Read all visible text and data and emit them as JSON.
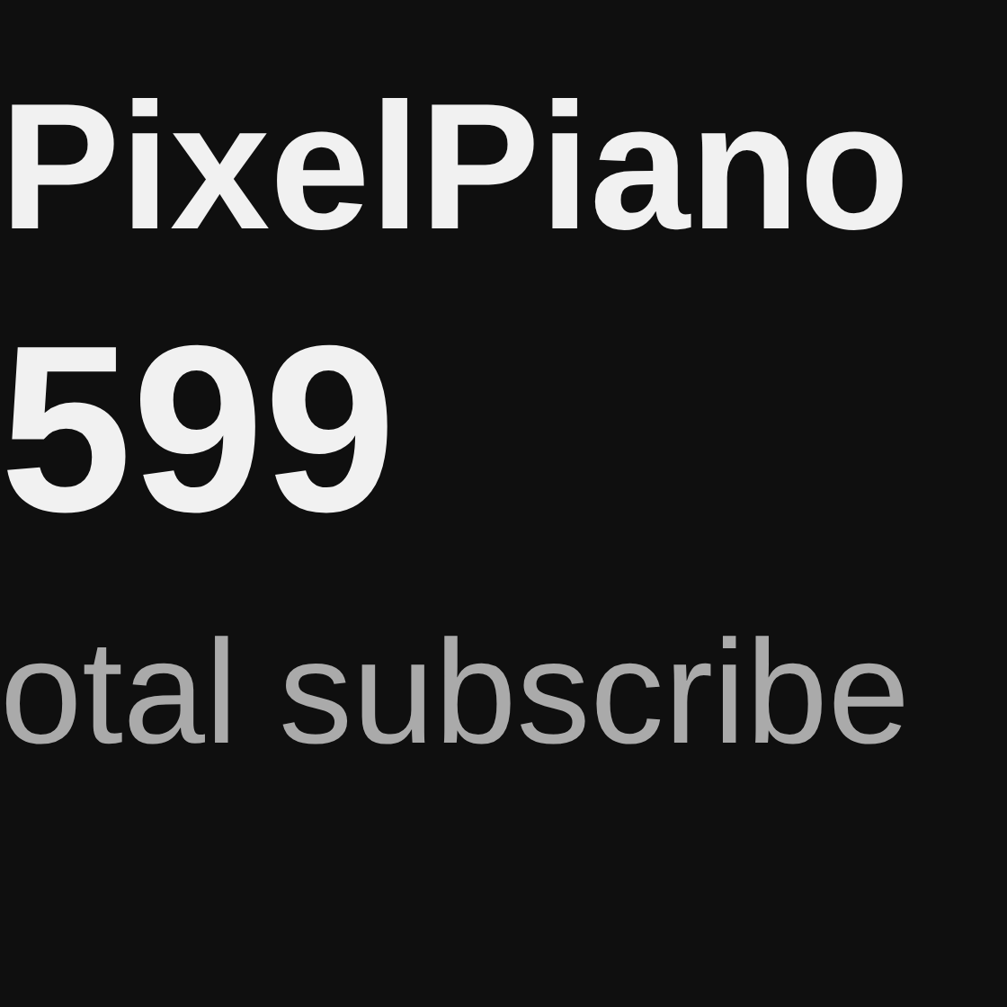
{
  "channel_name": "PixelPiano",
  "subscriber_count": "599",
  "subscriber_label": "otal subscribe"
}
